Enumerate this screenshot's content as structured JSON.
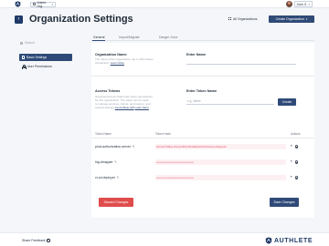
{
  "topbar": {
    "org_name": "Anime Org",
    "user_name": "John S"
  },
  "header": {
    "title": "Organization Settings",
    "all_orgs_label": "All Organizations",
    "create_org_label": "Create Organization"
  },
  "sidebar": {
    "search_placeholder": "Search",
    "items": [
      {
        "label": "Basic Settings"
      },
      {
        "label": "User Permissions"
      }
    ]
  },
  "tabs": [
    {
      "label": "General"
    },
    {
      "label": "Import/Migrate"
    },
    {
      "label": "Danger Zone"
    }
  ],
  "org_name": {
    "title": "Organization Name",
    "desc_line1": "The name of the organization (up to 100 charac-",
    "desc_line2": "characters).",
    "learn_more": "Learn More",
    "field_label": "Enter Name",
    "field_value": ""
  },
  "access_tokens": {
    "title": "Access Tokens",
    "desc_line1": "Generate Access Token with same permissions",
    "desc_line2": "for this organization. The token can be used",
    "desc_line3": "to manage services, clients, permissions, and",
    "desc_line4": "several settings",
    "desc_link": "via Authlete API",
    "learn_more": "Learn More",
    "field_label": "Enter Token Name",
    "field_placeholder": "e.g. Name",
    "create_label": "Create"
  },
  "token_table": {
    "headers": {
      "name": "Token Name",
      "token": "Token Hash",
      "actions": "Actions"
    },
    "rows": [
      {
        "name": "prod-authorization-server",
        "token": "s9cnF4TNt8qv-WLwr0rMxDTRvdB2hHfGz5bXuKsLm8aQe3w"
      },
      {
        "name": "hig-dmapper",
        "token": "••••••••••••••••••••••••••••••••••••••••••"
      },
      {
        "name": "ci-cd-deployer",
        "token": "••••••••••••••••••••••••••••••••••••••••••"
      }
    ]
  },
  "actions": {
    "discard_label": "Discard Changes",
    "save_label": "Save Changes"
  },
  "footer": {
    "share_feedback": "Share Feedback",
    "brand": "AUTHLETE"
  }
}
